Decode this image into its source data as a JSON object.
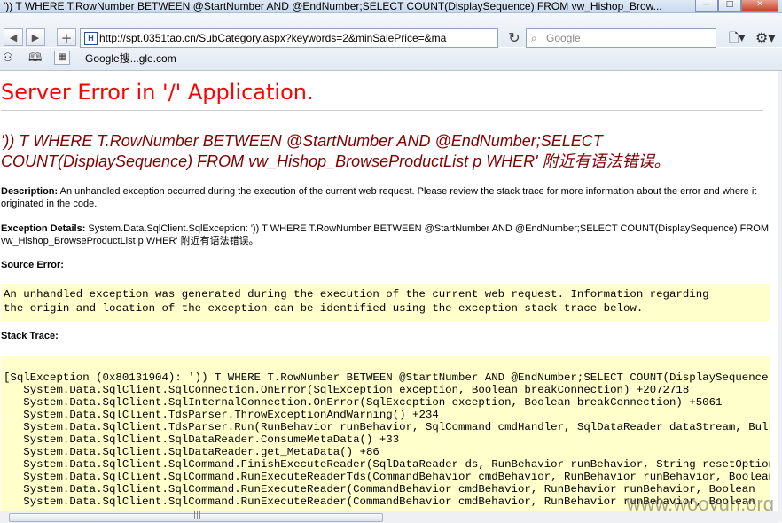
{
  "window": {
    "title": "')) T WHERE T.RowNumber BETWEEN @StartNumber AND @EndNumber;SELECT COUNT(DisplaySequence) FROM vw_Hishop_Brow...",
    "minimize": "—",
    "maximize": "□",
    "close": "✕"
  },
  "navbar": {
    "back_icon": "◀",
    "forward_icon": "▶",
    "new_tab_icon": "+",
    "url": "http://spt.0351tao.cn/SubCategory.aspx?keywords=2&minSalePrice=&ma",
    "site_icon": "H",
    "reload_icon": "↻",
    "search_placeholder": "Google",
    "search_icon": "⌕",
    "page_menu_icon": "🗋▾",
    "tools_menu_icon": "⚙▾"
  },
  "bookmarks": {
    "glasses_icon": "⚇",
    "book_icon": "🕮",
    "apps_icon": "▦",
    "item1": "Google搜...gle.com"
  },
  "page": {
    "heading": "Server Error in '/' Application.",
    "error_title": "')) T WHERE T.RowNumber BETWEEN @StartNumber AND @EndNumber;SELECT COUNT(DisplaySequence) FROM vw_Hishop_BrowseProductList p WHER' 附近有语法错误。",
    "description_label": "Description:",
    "description_text": " An unhandled exception occurred during the execution of the current web request. Please review the stack trace for more information about the error and where it originated in the code.",
    "exception_label": "Exception Details:",
    "exception_text": " System.Data.SqlClient.SqlException: ')) T WHERE T.RowNumber BETWEEN @StartNumber AND @EndNumber;SELECT COUNT(DisplaySequence) FROM vw_Hishop_BrowseProductList p WHER' 附近有语法错误。",
    "source_error_label": "Source Error:",
    "source_error_text": "An unhandled exception was generated during the execution of the current web request. Information regarding\nthe origin and location of the exception can be identified using the exception stack trace below.",
    "stack_trace_label": "Stack Trace:",
    "stack_trace_text": "[SqlException (0x80131904): ')) T WHERE T.RowNumber BETWEEN @StartNumber AND @EndNumber;SELECT COUNT(DisplaySequence) FROM vw\n   System.Data.SqlClient.SqlConnection.OnError(SqlException exception, Boolean breakConnection) +2072718\n   System.Data.SqlClient.SqlInternalConnection.OnError(SqlException exception, Boolean breakConnection) +5061\n   System.Data.SqlClient.TdsParser.ThrowExceptionAndWarning() +234\n   System.Data.SqlClient.TdsParser.Run(RunBehavior runBehavior, SqlCommand cmdHandler, SqlDataReader dataStream, BulkCopy\n   System.Data.SqlClient.SqlDataReader.ConsumeMetaData() +33\n   System.Data.SqlClient.SqlDataReader.get_MetaData() +86\n   System.Data.SqlClient.SqlCommand.FinishExecuteReader(SqlDataReader ds, RunBehavior runBehavior, String resetOptionsString\n   System.Data.SqlClient.SqlCommand.RunExecuteReaderTds(CommandBehavior cmdBehavior, RunBehavior runBehavior, Boolean\n   System.Data.SqlClient.SqlCommand.RunExecuteReader(CommandBehavior cmdBehavior, RunBehavior runBehavior, Boolean\n   System.Data.SqlClient.SqlCommand.RunExecuteReader(CommandBehavior cmdBehavior, RunBehavior runBehavior, Boolean",
    "watermark": "www.wooyun.org"
  },
  "scrollbar": {
    "grip": "|||"
  }
}
